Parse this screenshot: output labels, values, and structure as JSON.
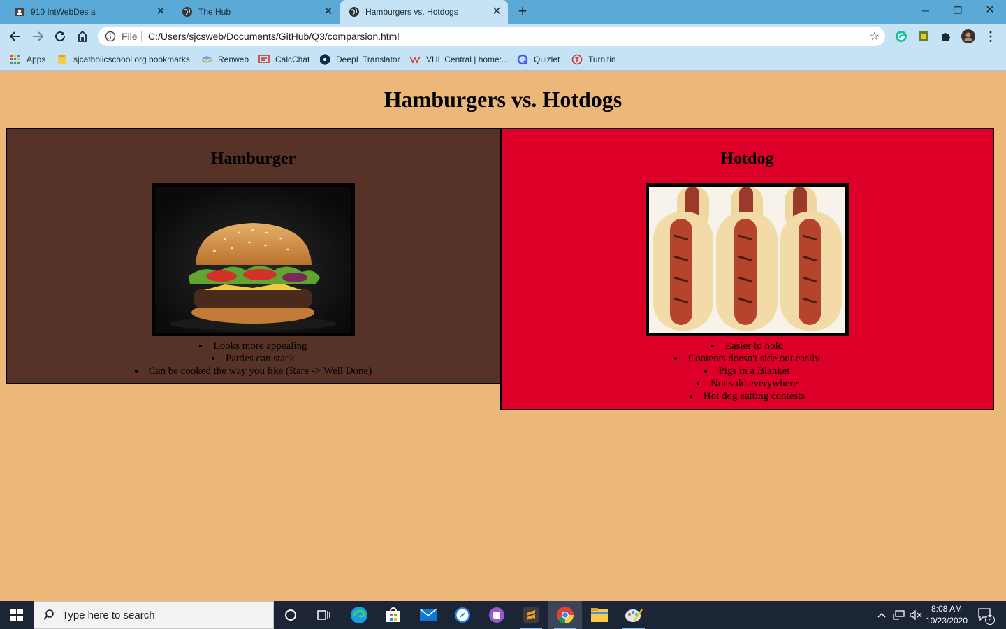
{
  "browser": {
    "tabs": [
      {
        "title": "910 IntWebDes a",
        "active": false
      },
      {
        "title": "The Hub",
        "active": false
      },
      {
        "title": "Hamburgers vs. Hotdogs",
        "active": true
      }
    ],
    "omnibox": {
      "scheme_label": "File",
      "url": "C:/Users/sjcsweb/Documents/GitHub/Q3/comparsion.html"
    },
    "bookmarks": [
      {
        "label": "Apps",
        "icon": "apps-grid-icon"
      },
      {
        "label": "sjcatholicschool.org bookmarks",
        "icon": "folder-icon"
      },
      {
        "label": "Renweb",
        "icon": "renweb-icon"
      },
      {
        "label": "CalcChat",
        "icon": "calcchat-icon"
      },
      {
        "label": "DeepL Translator",
        "icon": "deepl-icon"
      },
      {
        "label": "VHL Central | home:...",
        "icon": "vhl-icon"
      },
      {
        "label": "Quizlet",
        "icon": "quizlet-icon"
      },
      {
        "label": "Turnitin",
        "icon": "turnitin-icon"
      }
    ]
  },
  "page": {
    "title": "Hamburgers vs. Hotdogs",
    "panels": [
      {
        "heading": "Hamburger",
        "color": "#573227",
        "points": [
          "Looks more appealing",
          "Patties can stack",
          "Can be cooked the way you like (Rare -> Well Done)"
        ]
      },
      {
        "heading": "Hotdog",
        "color": "#dc0028",
        "points": [
          "Easier to hold",
          "Contents doesn't side out easily",
          "Pigs in a Blanket",
          "Not sold everywhere",
          "Hot dog eatting contests"
        ]
      }
    ]
  },
  "taskbar": {
    "search_placeholder": "Type here to search",
    "time": "8:08 AM",
    "date": "10/23/2020",
    "notifications": "2"
  },
  "colors": {
    "page_bg": "#ebb879",
    "tabstrip": "#5aa9d6",
    "toolbar": "#c5e3f4",
    "taskbar": "#1b2536"
  }
}
